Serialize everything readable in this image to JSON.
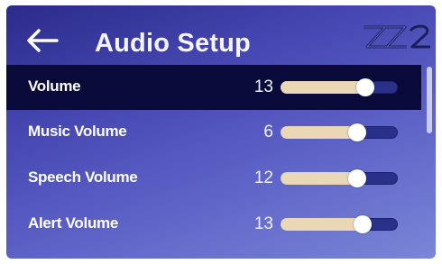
{
  "header": {
    "title": "Audio Setup",
    "back_icon": "arrow-left-icon",
    "logo_text": "ZZ2"
  },
  "settings": [
    {
      "label": "Volume",
      "value": "13",
      "level": 0.72,
      "selected": true
    },
    {
      "label": "Music Volume",
      "value": "6",
      "level": 0.65,
      "selected": false
    },
    {
      "label": "Speech Volume",
      "value": "12",
      "level": 0.65,
      "selected": false
    },
    {
      "label": "Alert Volume",
      "value": "13",
      "level": 0.7,
      "selected": false
    }
  ],
  "colors": {
    "selected_row": "#0a0a3a",
    "slider_fill": "#e9d7b5",
    "slider_track": "#28308a"
  }
}
